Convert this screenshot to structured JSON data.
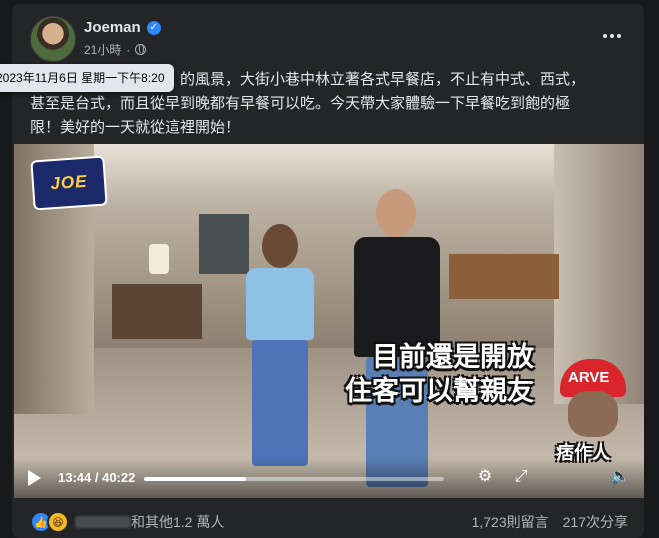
{
  "post": {
    "author": "Joeman",
    "time": "21小時",
    "timestamp_tooltip": "2023年11月6日 星期一下午8:20",
    "text": "　　　　　　　　　　的風景，大街小巷中林立著各式早餐店，不止有中式、西式，\n甚至是台式，而且從早到晚都有早餐可以吃。今天帶大家體驗一下早餐吃到飽的極\n限！美好的一天就從這裡開始！"
  },
  "video": {
    "logo_text": "JOE",
    "caption_line1": "目前還是開放",
    "caption_line2": "住客可以幫親友",
    "sticker_cap": "ARVE",
    "sticker_text": "痞作人",
    "current_time": "13:44",
    "duration": "40:22",
    "progress": 0.34
  },
  "engagement": {
    "reactions_text": "和其他1.2 萬人",
    "comments": "1,723則留言",
    "shares": "217次分享"
  },
  "icons": [
    "globe-icon",
    "verified-icon",
    "more-icon",
    "play-icon",
    "settings-icon",
    "fullscreen-icon",
    "volume-icon",
    "like-icon",
    "haha-icon"
  ]
}
